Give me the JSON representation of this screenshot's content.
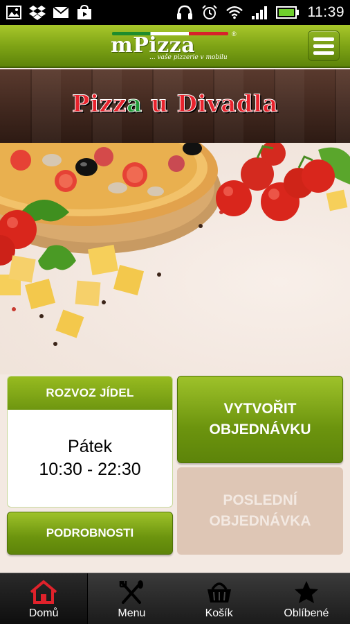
{
  "status_bar": {
    "time": "11:39",
    "left_icons": [
      "gallery-icon",
      "dropbox-icon",
      "gmail-icon",
      "play-store-icon"
    ],
    "right_icons": [
      "headset-icon",
      "alarm-icon",
      "wifi-icon",
      "signal-icon",
      "battery-icon"
    ]
  },
  "header": {
    "logo_text": "mPizza",
    "logo_reg": "®",
    "logo_tagline": "... vaše pizzerie v mobilu",
    "menu_icon": "hamburger-icon"
  },
  "banner": {
    "title_part1": "Pizz",
    "title_part2": "a",
    "title_part3": " u Divadla"
  },
  "delivery": {
    "header": "ROZVOZ JÍDEL",
    "day": "Pátek",
    "hours": "10:30 - 22:30"
  },
  "buttons": {
    "details": "PODROBNOSTI",
    "create_order_line1": "VYTVOŘIT",
    "create_order_line2": "OBJEDNÁVKU",
    "last_order_line1": "POSLEDNÍ",
    "last_order_line2": "OBJEDNÁVKA"
  },
  "bottom_nav": {
    "items": [
      {
        "label": "Domů",
        "icon": "home-icon",
        "active": true
      },
      {
        "label": "Menu",
        "icon": "cutlery-icon",
        "active": false
      },
      {
        "label": "Košík",
        "icon": "basket-icon",
        "active": false
      },
      {
        "label": "Oblíbené",
        "icon": "star-icon",
        "active": false
      }
    ]
  },
  "colors": {
    "brand_green": "#7fa416",
    "banner_red": "#e8232d",
    "disabled_button": "#dec6b5"
  }
}
